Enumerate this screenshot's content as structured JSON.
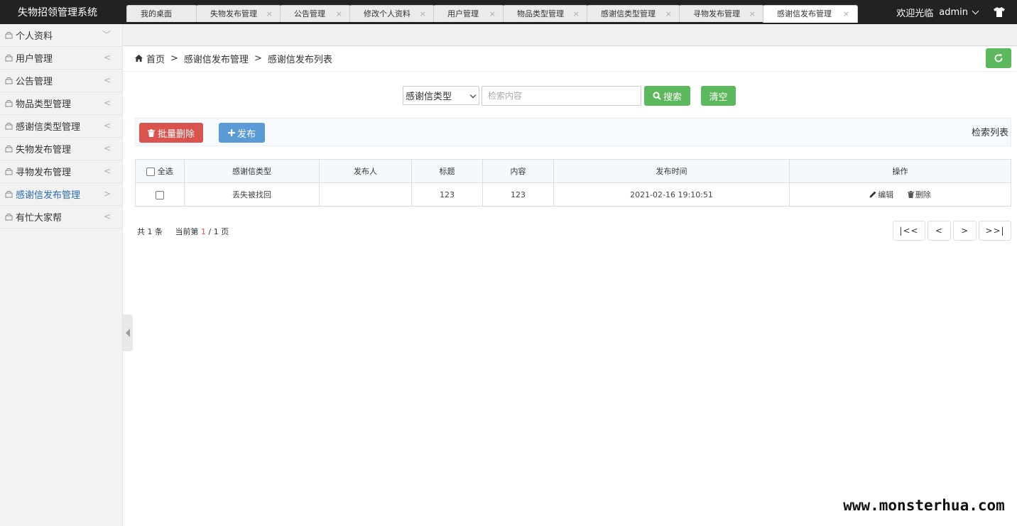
{
  "app": {
    "title": "失物招领管理系统"
  },
  "header": {
    "welcome": "欢迎光临",
    "user": "admin"
  },
  "sidebar": {
    "items": [
      {
        "label": "个人资料",
        "arrow": "﹀"
      },
      {
        "label": "用户管理",
        "arrow": "<"
      },
      {
        "label": "公告管理",
        "arrow": "<"
      },
      {
        "label": "物品类型管理",
        "arrow": "<"
      },
      {
        "label": "感谢信类型管理",
        "arrow": "<"
      },
      {
        "label": "失物发布管理",
        "arrow": "<"
      },
      {
        "label": "寻物发布管理",
        "arrow": "<"
      },
      {
        "label": "感谢信发布管理",
        "arrow": ">"
      },
      {
        "label": "有忙大家帮",
        "arrow": "<"
      }
    ]
  },
  "tabs": [
    {
      "label": "我的桌面"
    },
    {
      "label": "失物发布管理",
      "close": "×"
    },
    {
      "label": "公告管理",
      "close": "×"
    },
    {
      "label": "修改个人资料",
      "close": "×"
    },
    {
      "label": "用户管理",
      "close": "×"
    },
    {
      "label": "物品类型管理",
      "close": "×"
    },
    {
      "label": "感谢信类型管理",
      "close": "×"
    },
    {
      "label": "寻物发布管理",
      "close": "×"
    },
    {
      "label": "感谢信发布管理",
      "close": "×"
    }
  ],
  "breadcrumb": {
    "home": "首页",
    "sep": ">",
    "level1": "感谢信发布管理",
    "level2": "感谢信发布列表"
  },
  "search": {
    "select_value": "感谢信类型",
    "placeholder": "检索内容",
    "search_label": "搜索",
    "clear_label": "清空"
  },
  "toolbar": {
    "batch_delete_label": "批量删除",
    "publish_label": "发布",
    "list_title": "检索列表"
  },
  "table": {
    "select_all": "全选",
    "headers": [
      "感谢信类型",
      "发布人",
      "标题",
      "内容",
      "发布时间",
      "操作"
    ],
    "rows": [
      {
        "type": "丢失被找回",
        "publisher": "",
        "title": "123",
        "content": "123",
        "time": "2021-02-16 19:10:51",
        "edit": "编辑",
        "delete": "删除"
      }
    ]
  },
  "pagination": {
    "total_prefix": "共",
    "total": "1",
    "total_suffix": "条",
    "current_prefix": "当前第",
    "current": "1",
    "slash": "/",
    "pages": "1",
    "pages_suffix": "页",
    "first": "|<<",
    "prev": "<",
    "next": ">",
    "last": ">>|"
  },
  "watermark": "www.monsterhua.com",
  "colors": {
    "green": "#5cb85c",
    "red": "#d9534f",
    "blue": "#5b9bd5",
    "topbar": "#222222",
    "active": "#2a6bb0"
  }
}
